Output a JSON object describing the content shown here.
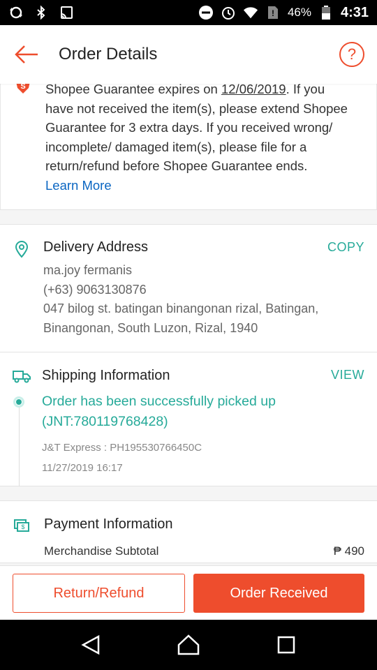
{
  "status_bar": {
    "battery_percent": "46%",
    "time": "4:31",
    "icons": [
      "sync-icon",
      "bluetooth-icon",
      "cast-icon",
      "dnd-icon",
      "alarm-icon",
      "wifi-icon",
      "no-sim-icon",
      "battery-icon"
    ]
  },
  "appbar": {
    "title": "Order Details",
    "help_label": "?"
  },
  "guarantee": {
    "text_before": "Shopee Guarantee expires on ",
    "date": "12/06/2019",
    "text_after": ". If you have not received the item(s), please extend Shopee Guarantee for 3 extra days. If you received wrong/ incomplete/ damaged item(s), please file for a return/refund before Shopee Guarantee ends.",
    "learn_more": "Learn More"
  },
  "delivery": {
    "title": "Delivery Address",
    "action": "COPY",
    "name": "ma.joy fermanis",
    "phone": "(+63) 9063130876",
    "address": "047 bilog st. batingan binangonan rizal, Batingan, Binangonan, South Luzon, Rizal, 1940"
  },
  "shipping": {
    "title": "Shipping Information",
    "action": "VIEW",
    "status": "Order has been successfully picked up (JNT:780119768428)",
    "courier": "J&T Express :  PH195530766450C",
    "timestamp": "11/27/2019 16:17"
  },
  "payment": {
    "title": "Payment Information",
    "subtotal_label": "Merchandise Subtotal",
    "subtotal_amount": "₱ 490"
  },
  "actions": {
    "return_label": "Return/Refund",
    "received_label": "Order Received"
  },
  "colors": {
    "brand": "#ee4d2d",
    "teal": "#26aa99",
    "link": "#0b66c2"
  }
}
